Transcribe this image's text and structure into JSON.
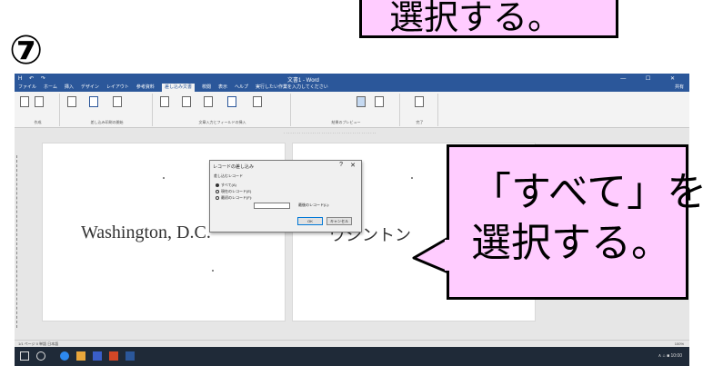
{
  "top_callout": {
    "text": "選択する。"
  },
  "step_number": "⑦",
  "word": {
    "qat": "H ↶ ↷",
    "title": "文書1 - Word",
    "window_buttons": "— ☐ ✕",
    "tabs": [
      "ファイル",
      "ホーム",
      "挿入",
      "デザイン",
      "レイアウト",
      "参考資料",
      "差し込み文書",
      "校閲",
      "表示",
      "ヘルプ",
      "実行したい作業を入力してください"
    ],
    "active_tab_index": 6,
    "share_label": "共有",
    "ribbon_groups": [
      "作成",
      "差し込み印刷の開始",
      "文章入力とフィールドの挿入",
      "結果のプレビュー",
      "完了"
    ],
    "page1_text": "Washington, D.C.",
    "page2_text": "ワシントン",
    "status_left": "1/1 ページ  0 単語  日本語",
    "status_right": "100%",
    "tray_text": "∧ ⌂ ■ 10:00"
  },
  "dialog": {
    "title": "レコードの差し込み",
    "help": "?",
    "close": "✕",
    "group_label": "差し込むレコード",
    "options": [
      "すべて(A)",
      "現在のレコード(E)",
      "最初のレコード(F):"
    ],
    "selected_index": 0,
    "to_label": "最後のレコード(L):",
    "ok_label": "OK",
    "cancel_label": "キャンセル"
  },
  "callout": {
    "line1": "「すべて」を",
    "line2": "選択する。"
  },
  "colors": {
    "callout_fill": "#ffccff",
    "word_blue": "#2b579a",
    "taskbar": "#1f2a38"
  }
}
